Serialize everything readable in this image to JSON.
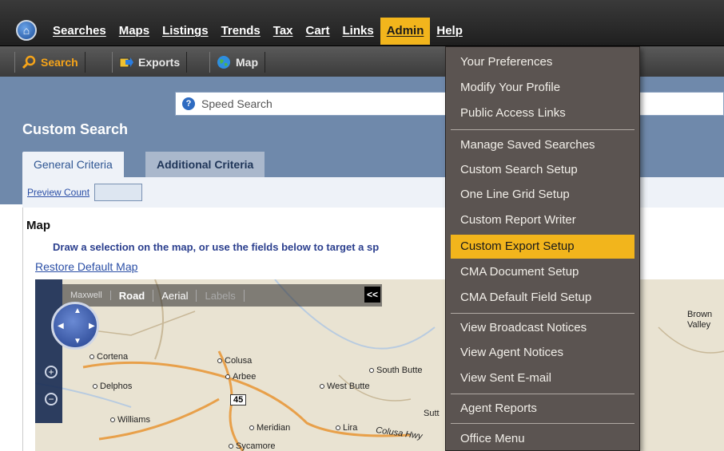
{
  "menubar": {
    "items": [
      {
        "label": "Searches"
      },
      {
        "label": "Maps"
      },
      {
        "label": "Listings"
      },
      {
        "label": "Trends"
      },
      {
        "label": "Tax"
      },
      {
        "label": "Cart"
      },
      {
        "label": "Links"
      },
      {
        "label": "Admin",
        "active": true
      },
      {
        "label": "Help"
      }
    ]
  },
  "toolbar": {
    "search_label": "Search",
    "exports_label": "Exports",
    "map_label": "Map"
  },
  "speed_search": {
    "placeholder": "Speed Search"
  },
  "page": {
    "title": "Custom Search",
    "tabs": [
      {
        "label": "General Criteria",
        "active": true
      },
      {
        "label": "Additional Criteria"
      }
    ],
    "preview_count_label": "Preview Count",
    "map_heading": "Map",
    "map_instructions": "Draw a selection on the map, or use the fields below to target a sp",
    "restore_link": "Restore Default Map"
  },
  "map": {
    "view_buttons": [
      "Road",
      "Aerial",
      "Labels"
    ],
    "collapse_label": "<<",
    "places": [
      "Maxwell",
      "Cortena",
      "Colusa",
      "Arbee",
      "Delphos",
      "West Butte",
      "South Butte",
      "Williams",
      "Meridian",
      "Lira",
      "Sycamore",
      "Sutt",
      "Brown Valley",
      "Colusa Hwy"
    ],
    "highway": "45"
  },
  "admin_menu": {
    "items": [
      {
        "label": "Your Preferences"
      },
      {
        "label": "Modify Your Profile"
      },
      {
        "label": "Public Access Links"
      },
      {
        "label": "Manage Saved Searches"
      },
      {
        "label": "Custom Search Setup"
      },
      {
        "label": "One Line Grid Setup"
      },
      {
        "label": "Custom Report Writer"
      },
      {
        "label": "Custom Export Setup",
        "highlighted": true
      },
      {
        "label": "CMA Document Setup"
      },
      {
        "label": "CMA Default Field Setup"
      },
      {
        "label": "View Broadcast Notices"
      },
      {
        "label": "View Agent Notices"
      },
      {
        "label": "View Sent E-mail"
      },
      {
        "label": "Agent Reports"
      },
      {
        "label": "Office Menu"
      }
    ]
  },
  "colors": {
    "menubar_bg": "#2a2a2a",
    "accent": "#f2b51c",
    "blue_panel": "#6f89ab",
    "dropdown_bg": "#5b5451"
  }
}
